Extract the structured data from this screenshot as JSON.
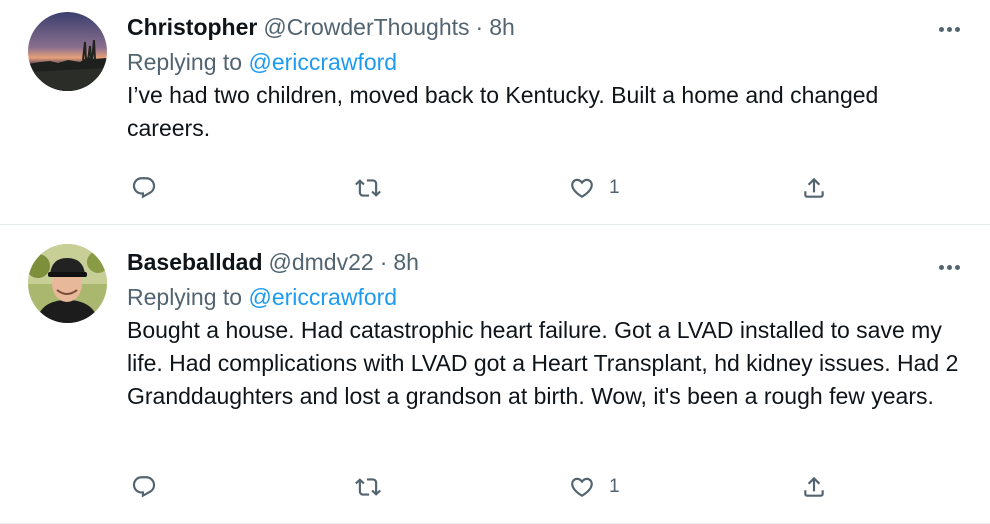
{
  "tweets": [
    {
      "name": "Christopher",
      "handle": "@CrowderThoughts",
      "dot": "·",
      "time": "8h",
      "replying_prefix": "Replying to ",
      "replying_to": "@ericcrawford",
      "text": "I’ve had two children, moved back to Kentucky. Built a home and changed careers.",
      "reply_count": "",
      "retweet_count": "",
      "like_count": "1",
      "avatar_icon": "sunset-landscape-avatar"
    },
    {
      "name": "Baseballdad",
      "handle": "@dmdv22",
      "dot": "·",
      "time": "8h",
      "replying_prefix": "Replying to ",
      "replying_to": "@ericcrawford",
      "text": "Bought a house. Had catastrophic heart failure. Got a LVAD installed to save my life. Had complications with LVAD got a Heart Transplant, hd kidney issues. Had 2 Granddaughters and lost a grandson at birth. Wow, it's been a rough few years.",
      "reply_count": "",
      "retweet_count": "",
      "like_count": "1",
      "avatar_icon": "man-with-cap-avatar"
    }
  ],
  "colors": {
    "primary_text": "#0f1419",
    "secondary_text": "#536471",
    "link": "#1d9bf0",
    "divider": "#e6ecf0"
  },
  "icons": [
    "reply-icon",
    "retweet-icon",
    "like-icon",
    "share-icon",
    "more-icon"
  ]
}
